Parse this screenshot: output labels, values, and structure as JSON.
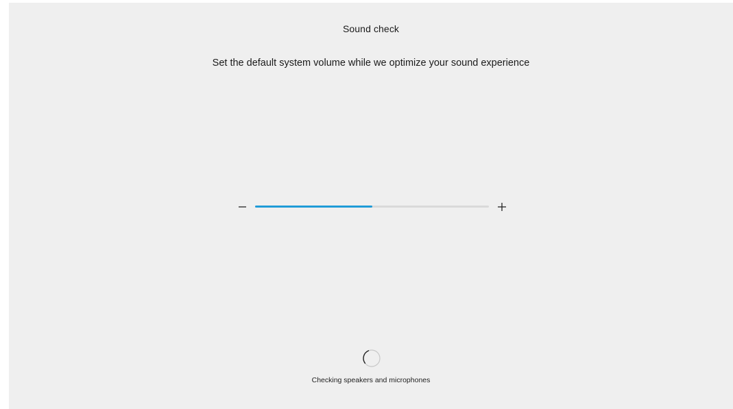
{
  "header": {
    "title": "Sound check",
    "subtitle": "Set the default system volume while we optimize your sound experience"
  },
  "volume": {
    "decrease_icon": "minus-icon",
    "increase_icon": "plus-icon",
    "level": 0.5,
    "accent_color": "#1f9bd7",
    "track_color": "#d9d9d9"
  },
  "status": {
    "icon": "loading-spinner-icon",
    "text": "Checking speakers and microphones"
  },
  "colors": {
    "background": "#efefef"
  }
}
